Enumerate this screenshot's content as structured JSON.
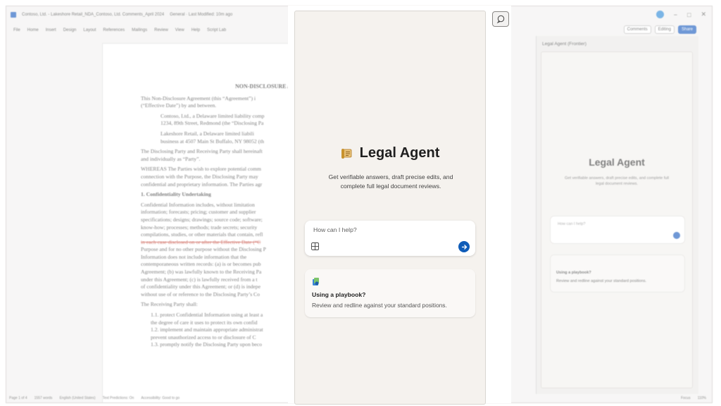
{
  "window": {
    "title": "Contoso, Ltd. - Lakeshore Retail_NDA_Contoso, Ltd. Comments_April 2024",
    "saved_status": "General · Last Modified: 10m ago",
    "controls": [
      "−",
      "□",
      "✕"
    ]
  },
  "menu": [
    "File",
    "Home",
    "Insert",
    "Design",
    "Layout",
    "References",
    "Mailings",
    "Review",
    "View",
    "Help",
    "Script Lab"
  ],
  "ribbon_right": {
    "comments": "Comments",
    "editing": "Editing",
    "share": "Share"
  },
  "document": {
    "title": "NON-DISCLOSURE AG",
    "paragraphs": [
      "This Non-Disclosure Agreement (this “Agreement”) i",
      "(“Effective Date”) by and between.",
      "Contoso, Ltd., a Delaware limited liability comp",
      "1234, 89th Street, Redmond (the “Disclosing Pa",
      "Lakeshore Retail, a Delaware limited liabili",
      "business at 4507 Main St Buffalo, NY 98052 (th",
      "The Disclosing Party and Receiving Party shall hereinaft",
      "and individually as “Party”.",
      "WHEREAS The Parties wish to explore potential comm",
      "connection with the Purpose, the Disclosing Party may",
      "confidential and proprietary information. The Parties agr",
      "1.  Confidentiality Undertaking",
      "Confidential Information includes, without limitation",
      "information; forecasts; pricing; customer and supplier",
      "specifications; designs; drawings; source code; software;",
      "know-how; processes; methods; trade secrets; security",
      "compilations, studies, or other materials that contain, refl",
      "in each case disclosed on or after the Effective Date (“C",
      "Purpose and for no other purpose without the Disclosing P",
      "Information does not include information that the",
      "contemporaneous written records: (a) is or becomes pub",
      "Agreement; (b) was lawfully known to the Receiving Pa",
      "under this Agreement; (c) is lawfully received from a t",
      "of confidentiality under this Agreement; or (d) is indepe",
      "without use of or reference to the Disclosing Party’s Co",
      "The Receiving Party shall:",
      "1.1.  protect Confidential Information using at least a",
      "the degree of care it uses to protect its own confid",
      "1.2.  implement and maintain appropriate administrat",
      "prevent unauthorized access to or disclosure of C",
      "1.3.  promptly notify the Disclosing Party upon beco"
    ]
  },
  "statusbar": [
    "Page 1 of 4",
    "1557 words",
    "English (United States)",
    "Text Predictions: On",
    "Accessibility: Good to go",
    "Focus",
    "110%"
  ],
  "side_pane": {
    "title": "Legal Agent (Frontier)",
    "heading": "Legal Agent",
    "subtitle": "Get verifiable answers, draft precise edits, and complete full legal document reviews.",
    "placeholder": "How can I help?",
    "card_title": "Using a playbook?",
    "card_desc": "Review and redline against your standard positions."
  },
  "agent": {
    "name": "Legal Agent",
    "subtitle": "Get verifiable answers, draft precise edits, and complete full legal document reviews.",
    "input_placeholder": "How can I help?",
    "playbook_title": "Using a playbook?",
    "playbook_desc": "Review and redline against your standard positions."
  },
  "colors": {
    "accent": "#0f5cb8",
    "panel_bg": "#f5f2ee",
    "scroll_icon": "#c8922d"
  }
}
